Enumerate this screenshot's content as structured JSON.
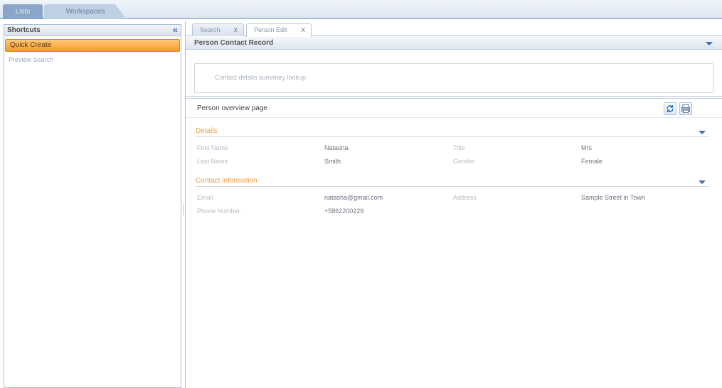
{
  "top_tabs": [
    {
      "label": "Lists"
    },
    {
      "label": "Workspaces"
    }
  ],
  "shortcuts": {
    "title": "Shortcuts",
    "collapse_icon": "double-chevron-left",
    "items": [
      {
        "label": "Quick Create"
      },
      {
        "label": "Preview Search"
      }
    ]
  },
  "content_tabs": [
    {
      "label": "Search",
      "close": "x"
    },
    {
      "label": "Person Edit",
      "close": "x"
    }
  ],
  "section": {
    "title": "Person Contact Record"
  },
  "search_box": {
    "text": "Contact details summary lookup"
  },
  "record": {
    "title": "Person overview page",
    "refresh_icon": "refresh-icon",
    "print_icon": "print-icon"
  },
  "groups": [
    {
      "title": "Details",
      "fields": [
        {
          "label": "First Name",
          "value": "Natasha"
        },
        {
          "label": "Last Name",
          "value": "Smith"
        },
        {
          "label": "Title",
          "value": "Mrs"
        },
        {
          "label": "Gender",
          "value": "Female"
        }
      ]
    },
    {
      "title": "Contact information",
      "fields": [
        {
          "label": "Email",
          "value": "natasha@gmail.com"
        },
        {
          "label": "Phone Number",
          "value": "+5862200229"
        },
        {
          "label": "Address",
          "value": "Sample Street in Town"
        }
      ]
    }
  ],
  "colors": {
    "accent": "#f59a2c",
    "border": "#a9bcd6",
    "link": "#3d6fb0"
  }
}
